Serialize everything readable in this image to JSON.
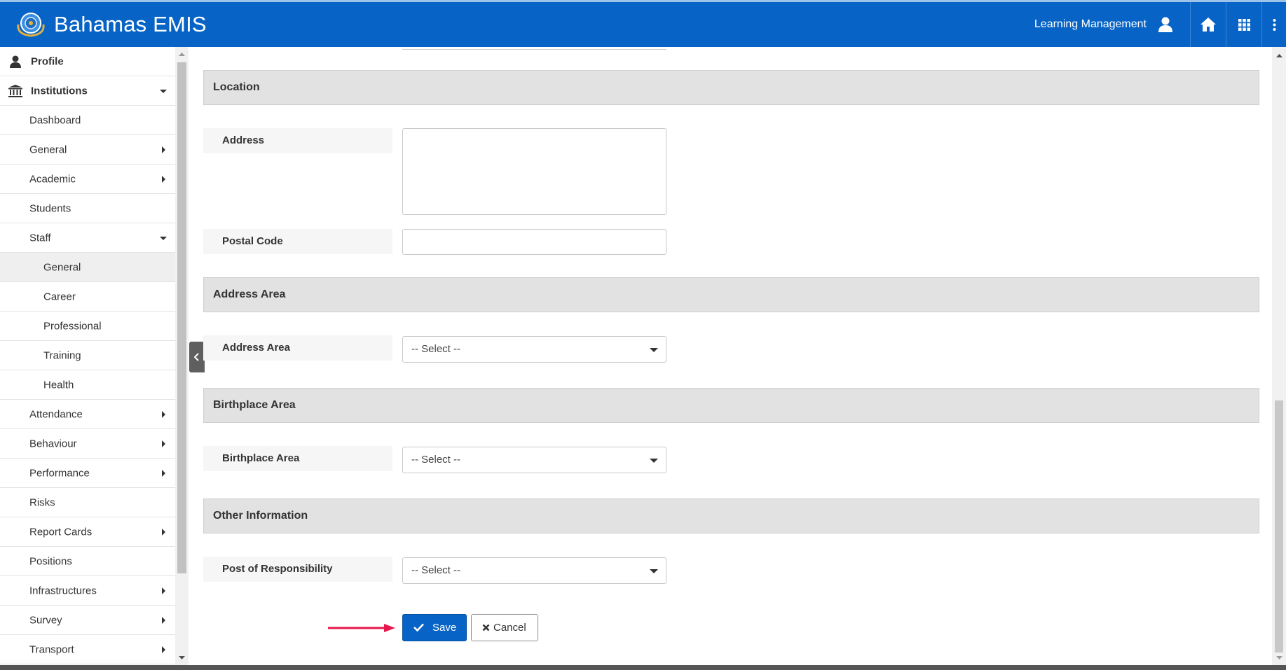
{
  "header": {
    "brand": "Bahamas EMIS",
    "module": "Learning Management",
    "colors": {
      "bar": "#0764c6",
      "text": "#ffffff"
    },
    "icons": [
      "user-icon",
      "home-icon",
      "apps-grid-icon",
      "more-vertical-icon"
    ]
  },
  "sidebar": {
    "profile": "Profile",
    "institutions": "Institutions",
    "items": [
      {
        "label": "Dashboard"
      },
      {
        "label": "General"
      },
      {
        "label": "Academic"
      },
      {
        "label": "Students"
      },
      {
        "label": "Staff"
      },
      {
        "label": "General"
      },
      {
        "label": "Career"
      },
      {
        "label": "Professional"
      },
      {
        "label": "Training"
      },
      {
        "label": "Health"
      },
      {
        "label": "Attendance"
      },
      {
        "label": "Behaviour"
      },
      {
        "label": "Performance"
      },
      {
        "label": "Risks"
      },
      {
        "label": "Report Cards"
      },
      {
        "label": "Positions"
      },
      {
        "label": "Infrastructures"
      },
      {
        "label": "Survey"
      },
      {
        "label": "Transport"
      }
    ]
  },
  "form": {
    "location": {
      "heading": "Location",
      "address_label": "Address",
      "address_value": "",
      "postal_code_label": "Postal Code",
      "postal_code_value": ""
    },
    "address_area": {
      "heading": "Address Area",
      "label": "Address Area",
      "value": "-- Select --"
    },
    "birthplace_area": {
      "heading": "Birthplace Area",
      "label": "Birthplace Area",
      "value": "-- Select --"
    },
    "other_information": {
      "heading": "Other Information",
      "label": "Post of Responsibility",
      "value": "-- Select --"
    }
  },
  "actions": {
    "save": "Save",
    "cancel": "Cancel",
    "accent": "#e8174b"
  }
}
